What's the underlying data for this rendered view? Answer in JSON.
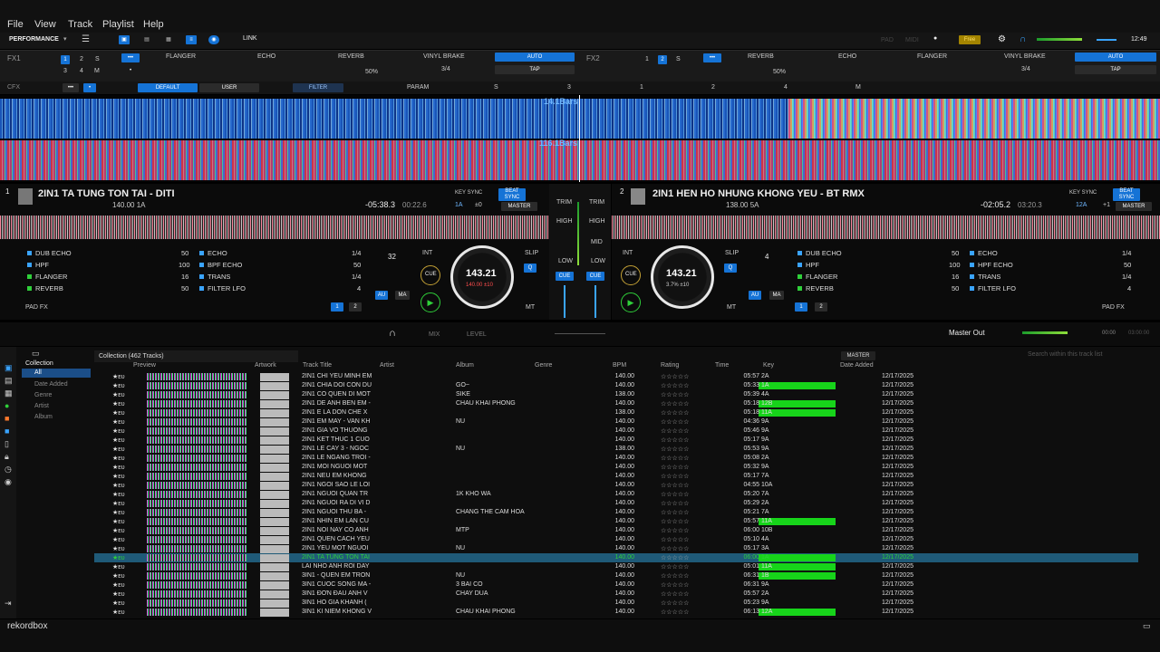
{
  "menu": {
    "file": "File",
    "view": "View",
    "track": "Track",
    "playlist": "Playlist",
    "help": "Help"
  },
  "top": {
    "mode": "PERFORMANCE",
    "link": "LINK",
    "pad": "PAD",
    "midi": "MIDI",
    "free": "Free",
    "time": "12:49"
  },
  "fx1": {
    "label": "FX1",
    "slots": [
      "FLANGER",
      "ECHO",
      "REVERB"
    ],
    "brake": "VINYL BRAKE",
    "auto": "AUTO",
    "tap": "TAP",
    "pct": "50%",
    "ratio": "3/4"
  },
  "fx2": {
    "label": "FX2",
    "slots": [
      "REVERB",
      "ECHO",
      "FLANGER"
    ],
    "brake": "VINYL BRAKE",
    "auto": "AUTO",
    "tap": "TAP",
    "pct": "50%",
    "ratio": "3/4"
  },
  "cfx": {
    "label": "CFX",
    "default": "DEFAULT",
    "user": "USER",
    "filter": "FILTER",
    "param": "PARAM",
    "s": "S",
    "nums": [
      "3",
      "1",
      "2",
      "4",
      "M"
    ]
  },
  "wave": {
    "bars1": "14.1Bars",
    "bars2": "116.1Bars"
  },
  "deck1": {
    "num": "1",
    "title": "2IN1 TA TUNG TON TAI - DITI",
    "bpm": "140.00 1A",
    "remain": "-05:38.3",
    "elapsed": "00:22.6",
    "keysync": "KEY SYNC",
    "beatsync": "BEAT SYNC",
    "master": "MASTER",
    "key": "1A",
    "keyoff": "±0",
    "beat": "32",
    "int": "INT",
    "slip": "SLIP",
    "jogbpm": "143.21",
    "jogsub": "140.00 ±10",
    "cue": "CUE",
    "fx": [
      [
        "DUB ECHO",
        "50"
      ],
      [
        "HPF",
        "100"
      ],
      [
        "FLANGER",
        "16"
      ],
      [
        "REVERB",
        "50"
      ]
    ],
    "fx2": [
      [
        "ECHO",
        "1/4"
      ],
      [
        "BPF ECHO",
        "50"
      ],
      [
        "TRANS",
        "1/4"
      ],
      [
        "FILTER LFO",
        "4"
      ]
    ],
    "padfx": "PAD FX",
    "au": "AU",
    "ma": "MA",
    "mt": "MT"
  },
  "deck2": {
    "num": "2",
    "title": "2IN1 HEN HO NHUNG KHONG YEU - BT RMX",
    "bpm": "138.00 5A",
    "remain": "-02:05.2",
    "elapsed": "03:20.3",
    "keysync": "KEY SYNC",
    "beatsync": "BEAT SYNC",
    "master": "MASTER",
    "key": "12A",
    "keyoff": "+1",
    "beat": "4",
    "int": "INT",
    "slip": "SLIP",
    "jogbpm": "143.21",
    "jogsub": "3.7% ±10",
    "cue": "CUE",
    "fx": [
      [
        "DUB ECHO",
        "50"
      ],
      [
        "HPF",
        "100"
      ],
      [
        "FLANGER",
        "16"
      ],
      [
        "REVERB",
        "50"
      ]
    ],
    "fx2": [
      [
        "ECHO",
        "1/4"
      ],
      [
        "HPF ECHO",
        "50"
      ],
      [
        "TRANS",
        "1/4"
      ],
      [
        "FILTER LFO",
        "4"
      ]
    ],
    "padfx": "PAD FX",
    "au": "AU",
    "ma": "MA",
    "mt": "MT"
  },
  "mixer": {
    "trim": "TRIM",
    "high": "HIGH",
    "mid": "MID",
    "low": "LOW",
    "cue": "CUE",
    "mix": "MIX",
    "level": "LEVEL",
    "masterout": "Master Out",
    "t1": "00:00",
    "t2": "03:00:00"
  },
  "browser": {
    "collection": "Collection",
    "all": "All",
    "items": [
      "Date Added",
      "Genre",
      "Artist",
      "Album"
    ],
    "count": "Collection (462 Tracks)",
    "master": "MASTER",
    "search": "Search within this track list",
    "cols": [
      "Preview",
      "Artwork",
      "Track Title",
      "Artist",
      "Album",
      "Genre",
      "BPM",
      "Rating",
      "Time",
      "Key",
      "Date Added"
    ],
    "rows": [
      [
        "2IN1 CHI YEU MINH EM",
        "",
        "",
        "140.00",
        "05:57",
        "2A",
        "12/17/2025",
        false
      ],
      [
        "2IN1 CHIA DOI CON DU",
        "",
        "GO~",
        "140.00",
        "05:33",
        "1A",
        "12/17/2025",
        true
      ],
      [
        "2IN1 CO QUEN DI MOT",
        "",
        "SIKE",
        "138.00",
        "05:39",
        "4A",
        "12/17/2025",
        false
      ],
      [
        "2IN1 DE ANH BEN EM -",
        "",
        "CHAU KHAI PHONG",
        "140.00",
        "05:18",
        "12B",
        "12/17/2025",
        true
      ],
      [
        "2IN1 E LA DON CHE X",
        "",
        "",
        "138.00",
        "05:18",
        "11A",
        "12/17/2025",
        true
      ],
      [
        "2IN1 EM MAY - VAN KH",
        "",
        "NU",
        "140.00",
        "04:36",
        "9A",
        "12/17/2025",
        false
      ],
      [
        "2IN1 GIA VO THUONG",
        "",
        "",
        "140.00",
        "05:46",
        "9A",
        "12/17/2025",
        false
      ],
      [
        "2IN1 KET THUC 1 CUO",
        "",
        "",
        "140.00",
        "05:17",
        "9A",
        "12/17/2025",
        false
      ],
      [
        "2IN1 LE CAY 3 - NGOC",
        "",
        "NU",
        "138.00",
        "05:53",
        "9A",
        "12/17/2025",
        false
      ],
      [
        "2IN1 LE NGANG TROI -",
        "",
        "",
        "140.00",
        "05:08",
        "2A",
        "12/17/2025",
        false
      ],
      [
        "2IN1 MOI NGUOI MOT",
        "",
        "",
        "140.00",
        "05:32",
        "9A",
        "12/17/2025",
        false
      ],
      [
        "2IN1 NEU EM KHONG",
        "",
        "",
        "140.00",
        "05:17",
        "7A",
        "12/17/2025",
        false
      ],
      [
        "2IN1 NGOI SAO LE LOI",
        "",
        "",
        "140.00",
        "04:55",
        "10A",
        "12/17/2025",
        false
      ],
      [
        "2IN1 NGUOI QUAN TR",
        "",
        "1K KHO WA",
        "140.00",
        "05:20",
        "7A",
        "12/17/2025",
        false
      ],
      [
        "2IN1 NGUOI RA DI VI D",
        "",
        "",
        "140.00",
        "05:29",
        "2A",
        "12/17/2025",
        false
      ],
      [
        "2IN1 NGUOI THU BA -",
        "",
        "CHẲNG THỂ CẦM HÓA",
        "140.00",
        "05:21",
        "7A",
        "12/17/2025",
        false
      ],
      [
        "2IN1 NHIN EM LAN CU",
        "",
        "",
        "140.00",
        "05:57",
        "11A",
        "12/17/2025",
        true
      ],
      [
        "2IN1 NOI NAY CO ANH",
        "",
        "MTP",
        "140.00",
        "06:00",
        "10B",
        "12/17/2025",
        false
      ],
      [
        "2IN1 QUEN CACH YEU",
        "",
        "",
        "140.00",
        "05:10",
        "4A",
        "12/17/2025",
        false
      ],
      [
        "2IN1 YEU MOT NGUOI",
        "",
        "NU",
        "140.00",
        "05:17",
        "3A",
        "12/17/2025",
        false
      ],
      [
        "2IN1 TA TUNG TON TAI",
        "",
        "",
        "140.00",
        "06:00",
        "1A",
        "12/17/2025",
        true
      ],
      [
        "LAI NHO ANH ROI DAY",
        "",
        "",
        "140.00",
        "05:01",
        "11A",
        "12/17/2025",
        true
      ],
      [
        "3IN1 - QUEN EM TRON",
        "",
        "NU",
        "140.00",
        "06:31",
        "1B",
        "12/17/2025",
        true
      ],
      [
        "3IN1 CUOC SONG MA -",
        "",
        "3 BAI CO",
        "140.00",
        "06:31",
        "9A",
        "12/17/2025",
        false
      ],
      [
        "3IN1 ĐƠN ĐAU ANH V",
        "",
        "CHAY DUA",
        "140.00",
        "05:57",
        "2A",
        "12/17/2025",
        false
      ],
      [
        "3IN1 HO GIA KHANH (",
        "",
        "",
        "140.00",
        "05:23",
        "9A",
        "12/17/2025",
        false
      ],
      [
        "3IN1 KI NIEM KHONG V",
        "",
        "CHAU KHAI PHONG",
        "140.00",
        "06:13",
        "12A",
        "12/17/2025",
        true
      ]
    ]
  },
  "footer": {
    "brand": "rekordbox"
  }
}
